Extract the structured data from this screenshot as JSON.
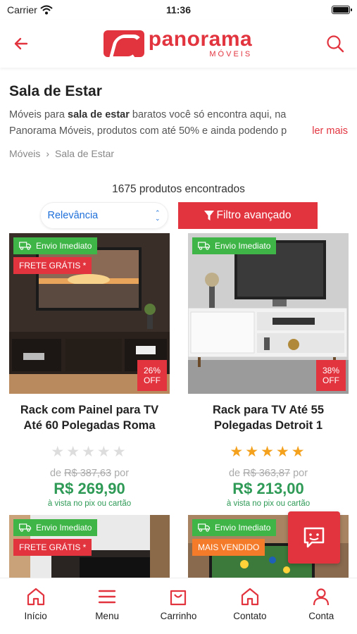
{
  "status": {
    "carrier": "Carrier",
    "time": "11:36"
  },
  "header": {
    "logo_main": "panorama",
    "logo_sub": "MÓVEIS",
    "back_icon": "arrow-left-icon",
    "search_icon": "search-icon"
  },
  "page": {
    "title": "Sala de Estar",
    "desc_prefix": "Móveis para ",
    "desc_bold": "sala de estar",
    "desc_rest": " baratos você só encontra aqui, na",
    "desc_line2": "Panorama Móveis, produtos com até 50% e ainda podendo p",
    "read_more": "ler mais",
    "breadcrumb": [
      "Móveis",
      "Sala de Estar"
    ],
    "count_text": "1675 produtos encontrados"
  },
  "controls": {
    "sort_value": "Relevância",
    "filter_label": "Filtro avançado"
  },
  "products": [
    {
      "badge_envio": "Envio Imediato",
      "badge2": "FRETE GRÁTIS *",
      "disc_pct": "26%",
      "disc_off": "OFF",
      "name_l1": "Rack com Painel para TV",
      "name_l2": "Até 60 Polegadas Roma",
      "rating": 0,
      "old_de": "de",
      "old_price": "R$ 387,63",
      "old_por": "por",
      "price": "R$ 269,90",
      "pix": "à vista no pix ou cartão"
    },
    {
      "badge_envio": "Envio Imediato",
      "badge2": "",
      "disc_pct": "38%",
      "disc_off": "OFF",
      "name_l1": "Rack para TV Até 55",
      "name_l2": "Polegadas Detroit 1",
      "rating": 5,
      "old_de": "de",
      "old_price": "R$ 363,87",
      "old_por": "por",
      "price": "R$ 213,00",
      "pix": "à vista no pix ou cartão"
    },
    {
      "badge_envio": "Envio Imediato",
      "badge2": "FRETE GRÁTIS *"
    },
    {
      "badge_envio": "Envio Imediato",
      "badge2": "MAIS VENDIDO"
    }
  ],
  "tabs": [
    {
      "label": "Início",
      "icon": "home-icon"
    },
    {
      "label": "Menu",
      "icon": "menu-icon"
    },
    {
      "label": "Carrinho",
      "icon": "shopping-bag-icon"
    },
    {
      "label": "Contato",
      "icon": "home-icon"
    },
    {
      "label": "Conta",
      "icon": "user-icon"
    }
  ],
  "colors": {
    "brand": "#e2343f",
    "green": "#2e9a56",
    "badge_green": "#3fb548",
    "orange": "#f47b2a",
    "link": "#1e6fd9",
    "star": "#f4a11d"
  }
}
